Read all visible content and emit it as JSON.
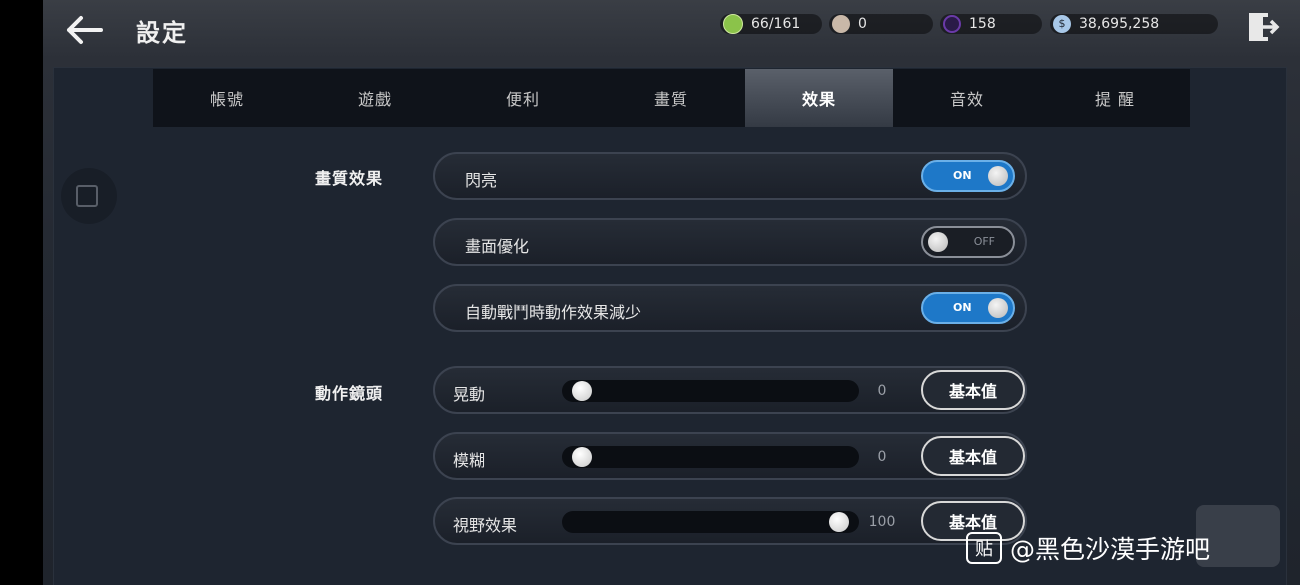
{
  "header": {
    "title": "設定",
    "resources": [
      {
        "icon": "stamina-icon",
        "value": "66/161",
        "color": "#8bc34a"
      },
      {
        "icon": "pearl-icon",
        "value": "0",
        "color": "#c9b8a8"
      },
      {
        "icon": "black-stone-icon",
        "value": "158",
        "color": "#6a3aa8"
      },
      {
        "icon": "silver-coin-icon",
        "value": "38,695,258",
        "color": "#a8c8e8"
      }
    ]
  },
  "tabs": [
    {
      "label": "帳號"
    },
    {
      "label": "遊戲"
    },
    {
      "label": "便利"
    },
    {
      "label": "畫質"
    },
    {
      "label": "效果",
      "active": true
    },
    {
      "label": "音效"
    },
    {
      "label": "提 醒"
    }
  ],
  "quality_effects": {
    "section_label": "畫質效果",
    "items": [
      {
        "label": "閃亮",
        "state": "ON",
        "on": true
      },
      {
        "label": "畫面優化",
        "state": "OFF",
        "on": false
      },
      {
        "label": "自動戰鬥時動作效果減少",
        "state": "ON",
        "on": true
      }
    ]
  },
  "camera": {
    "section_label": "動作鏡頭",
    "default_label": "基本值",
    "sliders": [
      {
        "label": "晃動",
        "value": "0",
        "fraction": 0
      },
      {
        "label": "模糊",
        "value": "0",
        "fraction": 0
      },
      {
        "label": "視野效果",
        "value": "100",
        "fraction": 1
      }
    ]
  },
  "watermark": {
    "badge": "贴",
    "text": "@黑色沙漠手游吧"
  },
  "colors": {
    "accent_on": "#1e78c8",
    "panel_bg": "#1e2530"
  }
}
